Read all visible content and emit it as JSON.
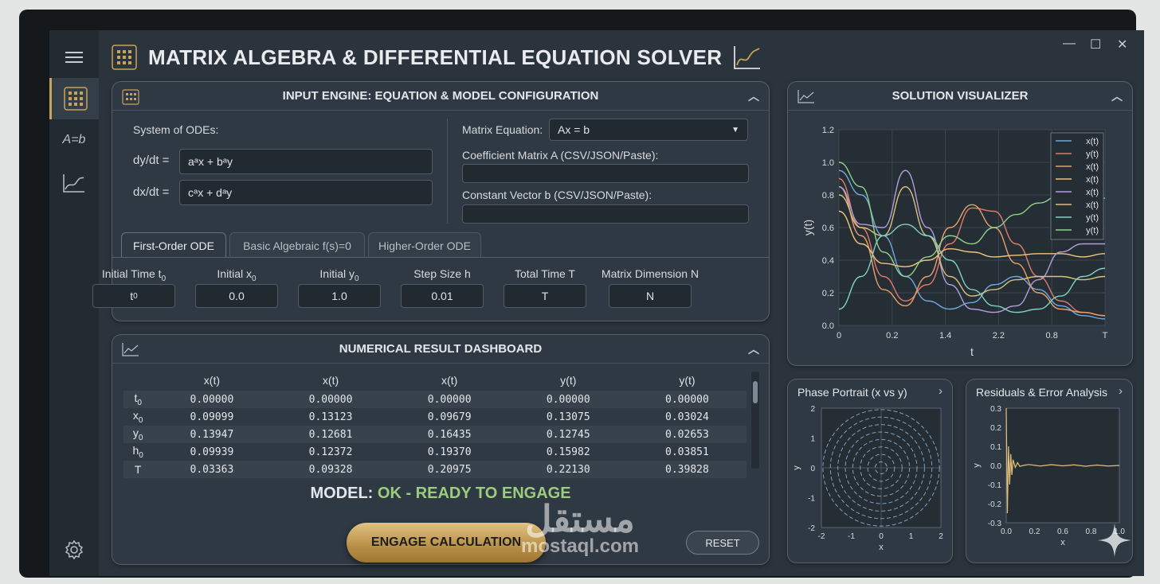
{
  "app": {
    "title": "MATRIX ALGEBRA & DIFFERENTIAL EQUATION SOLVER",
    "window_controls": {
      "minimize": "—",
      "maximize": "☐",
      "close": "✕"
    }
  },
  "sidebar": {
    "items": [
      {
        "name": "grid",
        "label": ""
      },
      {
        "name": "matrix",
        "label": "A=b"
      },
      {
        "name": "plot",
        "label": ""
      }
    ]
  },
  "input_panel": {
    "title": "INPUT ENGINE: EQUATION & MODEL CONFIGURATION",
    "system_label": "System of ODEs:",
    "eq1_label": "dy/dt =",
    "eq1_value": "aᵃx + bᵃy",
    "eq2_label": "dx/dt =",
    "eq2_value": "cᵃx + dᵃy",
    "matrix_eq_label": "Matrix Equation:",
    "matrix_eq_value": "Ax = b",
    "coef_label": "Coefficient Matrix A (CSV/JSON/Paste):",
    "coef_value": "",
    "const_label": "Constant Vector b (CSV/JSON/Paste):",
    "const_value": "",
    "tabs": [
      "First-Order ODE",
      "Basic Algebraic f(s)=0",
      "Higher-Order ODE"
    ],
    "params": [
      {
        "label": "Initial Time t",
        "sub": "0",
        "value": "t",
        "vsub": "0"
      },
      {
        "label": "Initial x",
        "sub": "0",
        "value": "0.0",
        "vsub": ""
      },
      {
        "label": "Initial y",
        "sub": "0",
        "value": "1.0",
        "vsub": ""
      },
      {
        "label": "Step Size h",
        "sub": "",
        "value": "0.01",
        "vsub": ""
      },
      {
        "label": "Total Time T",
        "sub": "",
        "value": "T",
        "vsub": ""
      },
      {
        "label": "Matrix Dimension N",
        "sub": "",
        "value": "N",
        "vsub": ""
      }
    ]
  },
  "results_panel": {
    "title": "NUMERICAL RESULT DASHBOARD",
    "columns": [
      "",
      "x(t)",
      "x(t)",
      "x(t)",
      "y(t)",
      "y(t)"
    ],
    "rows": [
      {
        "label": "t",
        "sub": "0",
        "values": [
          "0.00000",
          "0.00000",
          "0.00000",
          "0.00000",
          "0.00000"
        ]
      },
      {
        "label": "x",
        "sub": "0",
        "values": [
          "0.09099",
          "0.13123",
          "0.09679",
          "0.13075",
          "0.03024"
        ]
      },
      {
        "label": "y",
        "sub": "0",
        "values": [
          "0.13947",
          "0.12681",
          "0.16435",
          "0.12745",
          "0.02653"
        ]
      },
      {
        "label": "h",
        "sub": "0",
        "values": [
          "0.09939",
          "0.12372",
          "0.19370",
          "0.15982",
          "0.03851"
        ]
      },
      {
        "label": "T",
        "sub": "",
        "values": [
          "0.03363",
          "0.09328",
          "0.20975",
          "0.22130",
          "0.39828"
        ]
      }
    ],
    "status_prefix": "MODEL:",
    "status_value": "OK - READY TO ENGAGE",
    "engage_label": "ENGAGE CALCULATION",
    "reset_label": "RESET"
  },
  "visualizer": {
    "title": "SOLUTION VISUALIZER"
  },
  "phase": {
    "title": "Phase Portrait (x vs y)"
  },
  "residuals": {
    "title": "Residuals & Error Analysis"
  },
  "watermark": {
    "arabic": "مستقل",
    "latin": "mostaql.com"
  },
  "colors": {
    "accent_gold": "#c8a35a",
    "status_green": "#9ccc7e",
    "panel_bg": "#2f3943"
  },
  "chart_data": [
    {
      "type": "line",
      "title": "SOLUTION VISUALIZER",
      "xlabel": "t",
      "ylabel": "y(t)",
      "x_ticks": [
        "0",
        "0.2",
        "1.4",
        "2.2",
        "0.8",
        "T"
      ],
      "ylim": [
        0,
        1.2
      ],
      "y_ticks": [
        "0.0",
        "0.2",
        "0.4",
        "0.6",
        "0.8",
        "1.0",
        "1.2"
      ],
      "grid": true,
      "legend_position": "top-right",
      "x": [
        0,
        1,
        2,
        3,
        4,
        5,
        6,
        7,
        8,
        9,
        10,
        11,
        12
      ],
      "series": [
        {
          "name": "x(t)",
          "color": "#6fa8dc",
          "values": [
            0.95,
            0.8,
            0.55,
            0.3,
            0.15,
            0.1,
            0.14,
            0.25,
            0.3,
            0.22,
            0.12,
            0.06,
            0.04
          ]
        },
        {
          "name": "y(t)",
          "color": "#e07a6a",
          "values": [
            0.9,
            0.6,
            0.3,
            0.15,
            0.25,
            0.5,
            0.72,
            0.7,
            0.5,
            0.3,
            0.15,
            0.08,
            0.06
          ]
        },
        {
          "name": "x(t)",
          "color": "#e9a06a",
          "values": [
            0.85,
            0.55,
            0.22,
            0.12,
            0.3,
            0.6,
            0.74,
            0.6,
            0.38,
            0.2,
            0.1,
            0.08,
            0.06
          ]
        },
        {
          "name": "x(t)",
          "color": "#f2c47a",
          "values": [
            0.7,
            0.5,
            0.38,
            0.36,
            0.4,
            0.47,
            0.45,
            0.42,
            0.43,
            0.44,
            0.44,
            0.42,
            0.44
          ]
        },
        {
          "name": "x(t)",
          "color": "#b39ddb",
          "values": [
            0.85,
            0.62,
            0.6,
            0.95,
            0.6,
            0.25,
            0.1,
            0.08,
            0.12,
            0.28,
            0.45,
            0.5,
            0.5
          ]
        },
        {
          "name": "x(t)",
          "color": "#d7c47a",
          "values": [
            0.8,
            0.6,
            0.55,
            0.85,
            0.55,
            0.3,
            0.18,
            0.22,
            0.28,
            0.3,
            0.3,
            0.28,
            0.3
          ]
        },
        {
          "name": "y(t)",
          "color": "#7ed3c2",
          "values": [
            0.1,
            0.3,
            0.55,
            0.62,
            0.55,
            0.4,
            0.22,
            0.12,
            0.08,
            0.1,
            0.18,
            0.3,
            0.35
          ]
        },
        {
          "name": "y(t)",
          "color": "#8fd18b",
          "values": [
            1.0,
            0.85,
            0.45,
            0.3,
            0.42,
            0.55,
            0.5,
            0.6,
            0.68,
            0.75,
            0.8,
            0.78,
            0.78
          ]
        }
      ]
    },
    {
      "type": "scatter",
      "title": "Phase Portrait (x vs y)",
      "xlabel": "x",
      "ylabel": "y",
      "xlim": [
        -2,
        2
      ],
      "ylim": [
        -2,
        2
      ],
      "x_ticks": [
        "-2",
        "-1",
        "0",
        "1",
        "2"
      ],
      "y_ticks": [
        "2",
        "1",
        "0",
        "-1",
        "-2"
      ],
      "orbit_radii": [
        0.2,
        0.45,
        0.7,
        0.95,
        1.2,
        1.45,
        1.7,
        1.95
      ]
    },
    {
      "type": "line",
      "title": "Residuals & Error Analysis",
      "xlabel": "x",
      "ylabel": "y",
      "xlim": [
        0,
        1
      ],
      "ylim": [
        -0.3,
        0.3
      ],
      "x_ticks": [
        "0.0",
        "0.2",
        "0.6",
        "0.8",
        "1.0"
      ],
      "y_ticks": [
        "0.3",
        "0.2",
        "0.1",
        "0.0",
        "-0.1",
        "-0.2",
        "-0.3"
      ],
      "x": [
        0,
        0.01,
        0.02,
        0.03,
        0.04,
        0.05,
        0.06,
        0.08,
        0.1,
        0.12,
        0.15,
        0.2,
        0.3,
        0.4,
        0.5,
        0.6,
        0.7,
        0.8,
        0.9,
        1.0
      ],
      "values": [
        0.3,
        -0.25,
        0.1,
        -0.1,
        0.06,
        -0.05,
        0.03,
        -0.01,
        0.015,
        -0.005,
        0.0,
        0.005,
        -0.003,
        0.004,
        -0.002,
        0.003,
        -0.004,
        0.002,
        -0.003,
        0.0
      ]
    }
  ]
}
